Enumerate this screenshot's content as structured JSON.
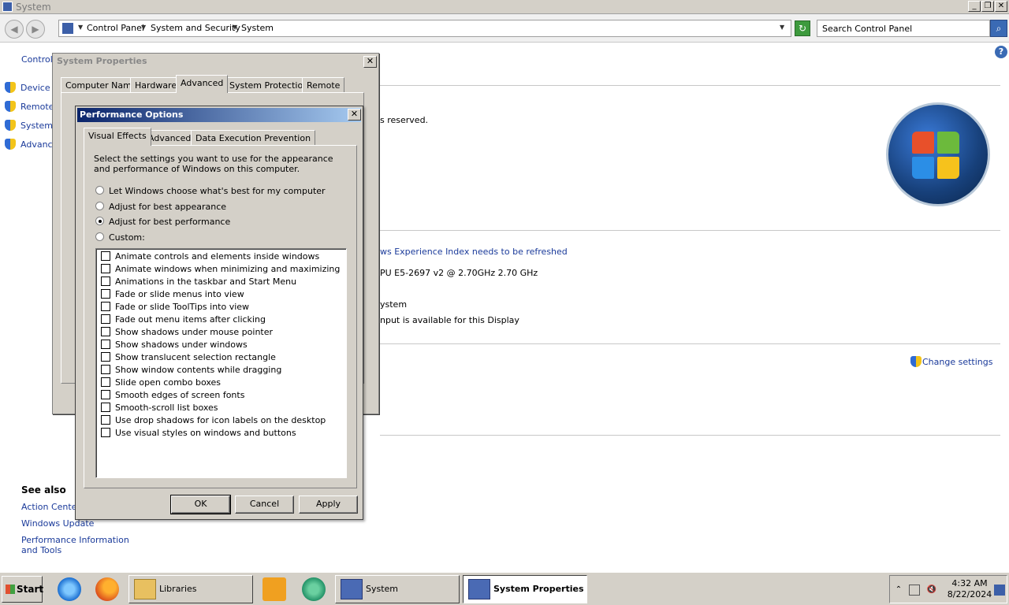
{
  "window": {
    "title": "System"
  },
  "breadcrumb": [
    "Control Panel",
    "System and Security",
    "System"
  ],
  "search": {
    "placeholder": "Search Control Panel"
  },
  "sidebar": {
    "title_partial": "Control",
    "items": [
      "Device M",
      "Remote",
      "System",
      "Advance"
    ],
    "see_also": "See also",
    "see_also_links": [
      "Action Center",
      "Windows Update",
      "Performance Information and Tools"
    ]
  },
  "content": {
    "rights_partial": "s reserved.",
    "wei_partial": "ws Experience Index needs to be refreshed",
    "cpu_partial": "PU E5-2697 v2 @ 2.70GHz   2.70 GHz",
    "system_partial": "ystem",
    "pen_partial": "nput is available for this Display",
    "change_settings": "Change settings"
  },
  "system_properties": {
    "title": "System Properties",
    "tabs": [
      "Computer Name",
      "Hardware",
      "Advanced",
      "System Protection",
      "Remote"
    ],
    "active_tab": "Advanced"
  },
  "performance_options": {
    "title": "Performance Options",
    "tabs": [
      "Visual Effects",
      "Advanced",
      "Data Execution Prevention"
    ],
    "active_tab": "Visual Effects",
    "description": "Select the settings you want to use for the appearance and performance of Windows on this computer.",
    "radios": [
      {
        "label": "Let Windows choose what's best for my computer",
        "checked": false
      },
      {
        "label": "Adjust for best appearance",
        "checked": false
      },
      {
        "label": "Adjust for best performance",
        "checked": true
      },
      {
        "label": "Custom:",
        "checked": false
      }
    ],
    "effects": [
      {
        "label": "Animate controls and elements inside windows",
        "checked": false
      },
      {
        "label": "Animate windows when minimizing and maximizing",
        "checked": false
      },
      {
        "label": "Animations in the taskbar and Start Menu",
        "checked": false
      },
      {
        "label": "Fade or slide menus into view",
        "checked": false
      },
      {
        "label": "Fade or slide ToolTips into view",
        "checked": false
      },
      {
        "label": "Fade out menu items after clicking",
        "checked": false
      },
      {
        "label": "Show shadows under mouse pointer",
        "checked": false
      },
      {
        "label": "Show shadows under windows",
        "checked": false
      },
      {
        "label": "Show translucent selection rectangle",
        "checked": false
      },
      {
        "label": "Show window contents while dragging",
        "checked": false
      },
      {
        "label": "Slide open combo boxes",
        "checked": false
      },
      {
        "label": "Smooth edges of screen fonts",
        "checked": false
      },
      {
        "label": "Smooth-scroll list boxes",
        "checked": false
      },
      {
        "label": "Use drop shadows for icon labels on the desktop",
        "checked": false
      },
      {
        "label": "Use visual styles on windows and buttons",
        "checked": false
      }
    ],
    "buttons": {
      "ok": "OK",
      "cancel": "Cancel",
      "apply": "Apply"
    }
  },
  "taskbar": {
    "start": "Start",
    "items": [
      "Libraries",
      "System",
      "System Properties"
    ],
    "active_item": "System Properties",
    "time": "4:32 AM",
    "date": "8/22/2024"
  },
  "icons": {
    "shield": "uac-shield-icon",
    "refresh": "refresh-icon",
    "search": "search-icon",
    "help": "help-icon"
  },
  "colors": {
    "link": "#1a3a9a",
    "dialog_face": "#d4d0c8",
    "active_title_start": "#0a246a",
    "active_title_end": "#a6caf0"
  }
}
